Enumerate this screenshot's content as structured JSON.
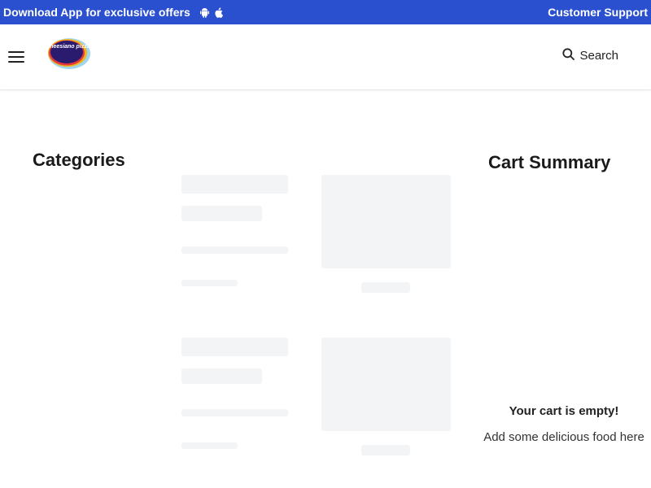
{
  "promo_bar": {
    "download_text": "Download App for exclusive offers",
    "support_link": "Customer Support",
    "icons": [
      "android-icon",
      "apple-icon"
    ]
  },
  "header": {
    "logo_text": "cheesiano pizza",
    "search_label": "Search",
    "icons": [
      "hamburger-menu-icon",
      "search-icon"
    ]
  },
  "main": {
    "categories_title": "Categories"
  },
  "cart": {
    "title": "Cart Summary",
    "empty_title": "Your cart is empty!",
    "empty_subtitle": "Add some delicious food here"
  },
  "colors": {
    "promo_bar_bg": "#2a4fcf",
    "skeleton": "#f3f4f6"
  }
}
